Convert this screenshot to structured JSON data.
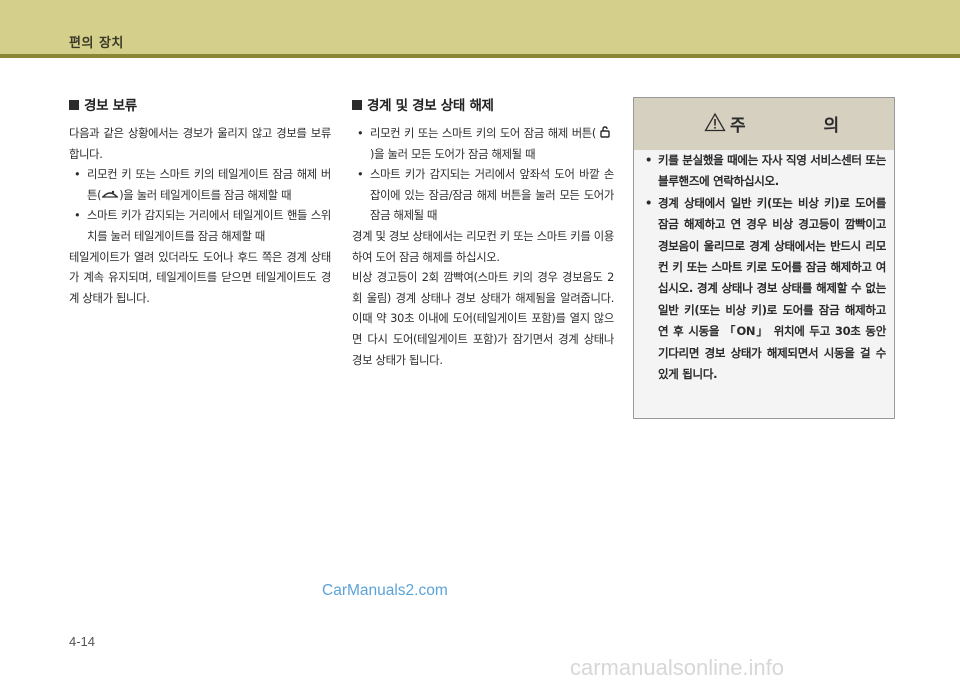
{
  "header": {
    "title": "편의 장치"
  },
  "left": {
    "title": "경보 보류",
    "intro": "다음과 같은 상황에서는 경보가 울리지 않고 경보를 보류합니다.",
    "bullet1_a": "리모컨 키 또는 스마트 키의 테일게이트 잠금 해제 버튼(",
    "bullet1_b": ")을 눌러 테일게이트를 잠금 해제할 때",
    "bullet2": "스마트 키가 감지되는 거리에서 테일게이트 핸들 스위치를 눌러 테일게이트를 잠금 해제할 때",
    "outro": "테일게이트가 열려 있더라도 도어나 후드 쪽은 경계 상태가 계속 유지되며, 테일게이트를 닫으면 테일게이트도 경계 상태가 됩니다."
  },
  "middle": {
    "title": "경계 및 경보 상태 해제",
    "bullet1_a": "리모컨 키 또는 스마트 키의 도어 잠금 해제 버튼(",
    "bullet1_b": ")을 눌러 모든 도어가 잠금 해제될 때",
    "bullet2": "스마트 키가 감지되는 거리에서 앞좌석 도어 바깥 손잡이에 있는 잠금/잠금 해제 버튼을 눌러 모든 도어가 잠금 해제될 때",
    "para1": "경계 및 경보 상태에서는 리모컨 키 또는 스마트 키를 이용하여 도어 잠금 해제를 하십시오.",
    "para2": "비상 경고등이 2회 깜빡여(스마트 키의 경우 경보음도 2회 울림) 경계 상태나 경보 상태가 해제됨을 알려줍니다. 이때 약 30초 이내에 도어(테일게이트 포함)를 열지 않으면 다시 도어(테일게이트 포함)가 잠기면서 경계 상태나 경보 상태가 됩니다."
  },
  "caution": {
    "title": "주 의",
    "bullet1": "키를 분실했을 때에는 자사 직영 서비스센터 또는 블루핸즈에 연락하십시오.",
    "bullet2": "경계 상태에서 일반 키(또는 비상 키)로 도어를 잠금 해제하고 연 경우 비상 경고등이 깜빡이고 경보음이 울리므로 경계 상태에서는 반드시 리모컨 키 또는 스마트 키로 도어를 잠금 해제하고 여십시오. 경계 상태나 경보 상태를 해제할 수 없는 일반 키(또는 비상 키)로 도어를 잠금 해제하고 연 후 시동을 「ON」 위치에 두고 30초 동안 기다리면 경보 상태가 해제되면서 시동을 걸 수 있게 됩니다."
  },
  "watermark": "CarManuals2.com",
  "page_number": "4-14",
  "footer_watermark": "carmanualsonline.info"
}
